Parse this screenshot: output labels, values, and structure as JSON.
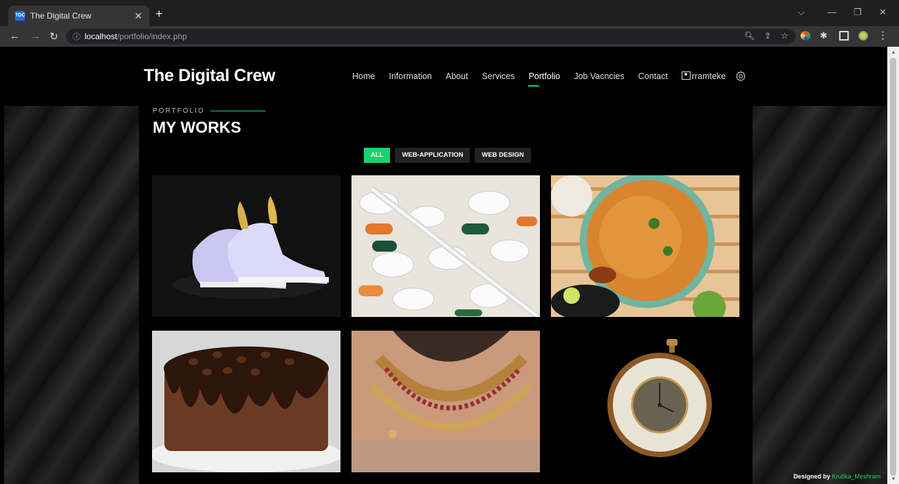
{
  "browser": {
    "tab_title": "The Digital Crew",
    "favicon_text": "TDC",
    "url_host": "localhost",
    "url_path": "/portfolio/index.php"
  },
  "site": {
    "logo": "The Digital Crew",
    "nav": [
      {
        "label": "Home",
        "active": false
      },
      {
        "label": "Information",
        "active": false
      },
      {
        "label": "About",
        "active": false
      },
      {
        "label": "Services",
        "active": false
      },
      {
        "label": "Portfolio",
        "active": true
      },
      {
        "label": "Job Vacncies",
        "active": false
      },
      {
        "label": "Contact",
        "active": false
      },
      {
        "label": "rramteke",
        "active": false
      }
    ],
    "accent_color": "#18d26e"
  },
  "portfolio": {
    "section_label": "PORTFOLIO",
    "title": "MY WORKS",
    "filters": [
      {
        "label": "ALL",
        "active": true
      },
      {
        "label": "WEB-APPLICATION",
        "active": false
      },
      {
        "label": "WEB DESIGN",
        "active": false
      }
    ],
    "items": [
      {
        "subject": "sneakers"
      },
      {
        "subject": "pills-thermometer"
      },
      {
        "subject": "biryani"
      },
      {
        "subject": "chocolate-cake"
      },
      {
        "subject": "necklace"
      },
      {
        "subject": "pocket-watch"
      }
    ]
  },
  "footer": {
    "credit_prefix": "Designed by",
    "credit_author": "Krutika_Meshram"
  }
}
